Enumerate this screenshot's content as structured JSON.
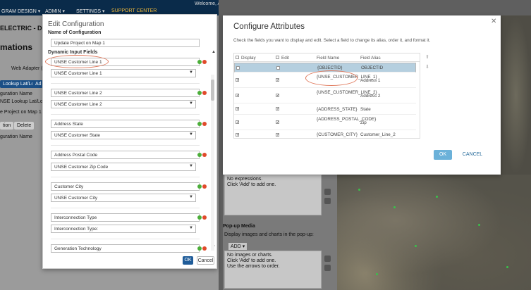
{
  "top_nav": {
    "items": [
      "GRAM DESIGN ▾",
      "ADMIN ▾",
      "SETTINGS ▾",
      "SUPPORT CENTER"
    ],
    "welcome": "Welcome, A"
  },
  "background_left": {
    "company": "ELECTRIC - DI",
    "section": "mations",
    "web_adapter": "Web Adapter (",
    "buttons": [
      "Lookup Lat/Long",
      "Ad"
    ],
    "col_header": "guration Name",
    "rows": [
      "NSE Lookup Lat/Long 1",
      "e Project on Map 1"
    ],
    "action_buttons": [
      "tion",
      "Delete"
    ],
    "col_header2": "guration Name"
  },
  "background_right": {
    "expressions_text": [
      "No expressions.",
      "Click 'Add' to add one."
    ],
    "popup_media": "Pop-up Media",
    "popup_media_desc": "Display images and charts in the pop-up:",
    "add_button": "ADD ▾",
    "media_text": [
      "No images or charts.",
      "Click 'Add' to add one.",
      "Use the arrows to order."
    ]
  },
  "edit_config": {
    "title": "Edit Configuration",
    "name_label": "Name of Configuration",
    "name_value": "Update Project on Map 1",
    "dynamic_label": "Dynamic Input Fields",
    "fields": [
      {
        "input": "UNSE Customer Line 1",
        "select": "UNSE Customer Line 1"
      },
      {
        "input": "UNSE Customer Line 2",
        "select": "UNSE Customer Line 2"
      },
      {
        "input": "Address State",
        "select": "UNSE Customer State"
      },
      {
        "input": "Address Postal Code",
        "select": "UNSE Customer Zip Code"
      },
      {
        "input": "Customer City",
        "select": "UNSE Customer City"
      },
      {
        "input": "Interconnection Type",
        "select": "Interconnection Type:"
      },
      {
        "input": "Generation Technology",
        "select": ""
      }
    ],
    "ok": "OK",
    "cancel": "Cancel"
  },
  "configure_attributes": {
    "title": "Configure Attributes",
    "description": "Check the fields you want to display and edit. Select a field to change its alias, order it, and format it.",
    "headers": {
      "display": "Display",
      "edit": "Edit",
      "field_name": "Field Name",
      "field_alias": "Field Alias"
    },
    "rows": [
      {
        "field_name": "{OBJECTID}",
        "alias": "OBJECTID",
        "display": false,
        "edit": false,
        "selected": true
      },
      {
        "field_name": "{UNSE_CUSTOMER_LINE_1}",
        "alias": "Address 1",
        "display": true,
        "edit": true,
        "selected": false
      },
      {
        "field_name": "{UNSE_CUSTOMER_LINE_2}",
        "alias": "Address 2",
        "display": true,
        "edit": true,
        "selected": false
      },
      {
        "field_name": "{ADDRESS_STATE}",
        "alias": "State",
        "display": true,
        "edit": true,
        "selected": false
      },
      {
        "field_name": "{ADDRESS_POSTAL_CODE}",
        "alias": "Zip",
        "display": true,
        "edit": true,
        "selected": false
      },
      {
        "field_name": "{CUSTOMER_CITY}",
        "alias": "Customer_Line_2",
        "display": true,
        "edit": true,
        "selected": false
      }
    ],
    "ok": "OK",
    "cancel": "CANCEL",
    "close_icon": "close-icon"
  },
  "colors": {
    "nav_bg": "#0a2b4a",
    "nav_active": "#f0b93a",
    "primary_button": "#1f5c99",
    "ok_button": "#6bb1d9",
    "selected_row": "#b5cfdf",
    "highlight_ellipse": "#e0795c"
  }
}
